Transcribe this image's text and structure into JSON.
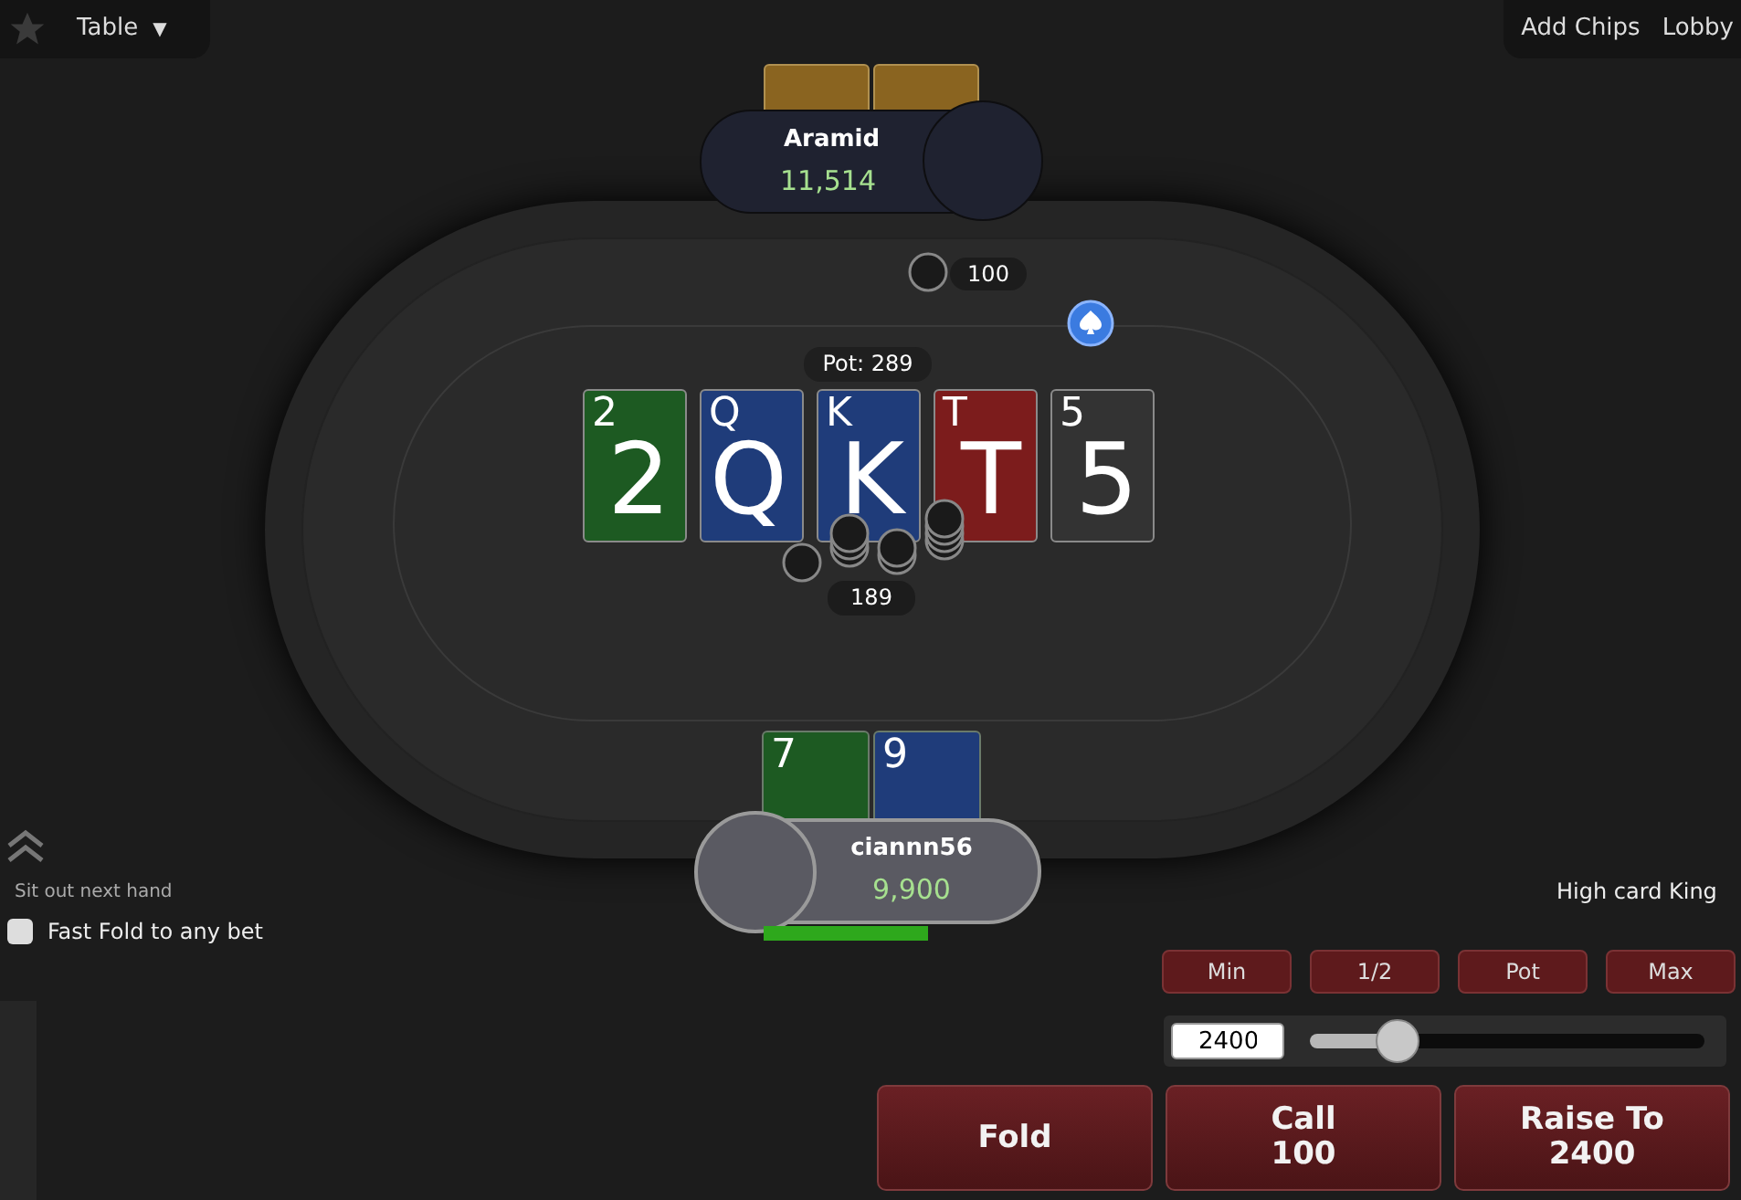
{
  "top_left": {
    "menu": "Table",
    "menu_caret": "▼"
  },
  "top_right": {
    "links": [
      "Add Chips",
      "Lobby"
    ]
  },
  "opponent": {
    "name": "Aramid",
    "stack": "11,514",
    "bet": "100"
  },
  "pot": "Pot: 289",
  "board": [
    {
      "corner": "2",
      "face": "2",
      "color": "#1d5a22"
    },
    {
      "corner": "Q",
      "face": "Q",
      "color": "#1f3c7a"
    },
    {
      "corner": "K",
      "face": "K",
      "color": "#1f3c7a"
    },
    {
      "corner": "T",
      "face": "T",
      "color": "#7c1c1c"
    },
    {
      "corner": "5",
      "face": "5",
      "color": "#333333"
    }
  ],
  "chips_total": "189",
  "hero": {
    "name": "ciannn56",
    "stack": "9,900",
    "cards": [
      {
        "corner": "7",
        "color": "#1d5a22"
      },
      {
        "corner": "9",
        "color": "#1f3c7a"
      }
    ]
  },
  "hand_strength": "High card King",
  "options": {
    "sit_out": "Sit out next hand",
    "fast_fold": {
      "label": "Fast Fold to any bet",
      "checked": false
    }
  },
  "bet_presets": [
    "Min",
    "1/2",
    "Pot",
    "Max"
  ],
  "bet_input": {
    "value": "2400",
    "slider": {
      "level": 0.22
    }
  },
  "actions": [
    {
      "label": "Fold"
    },
    {
      "label": "Call",
      "amount": "100"
    },
    {
      "label": "Raise To",
      "amount": "2400"
    }
  ]
}
